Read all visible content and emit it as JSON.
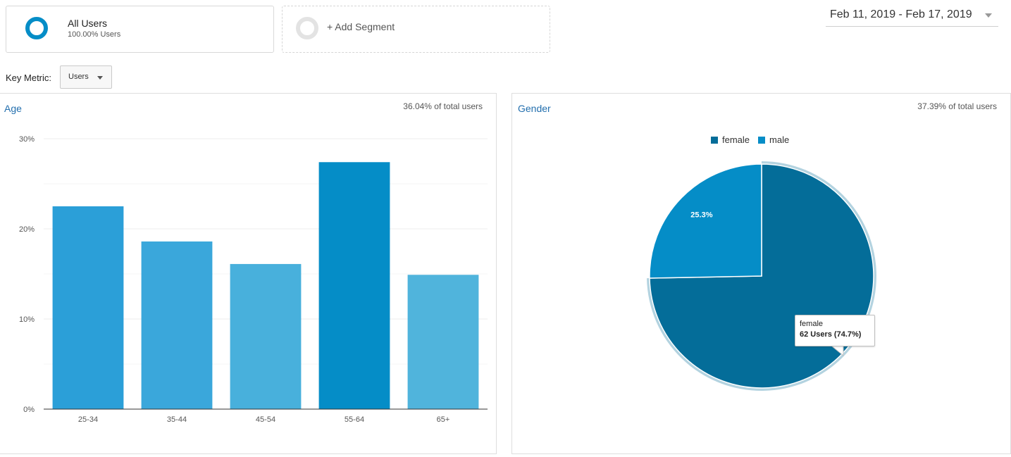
{
  "segments": {
    "active": {
      "name": "All Users",
      "subtitle": "100.00% Users",
      "color": "#058dc7"
    },
    "add_label": "+ Add Segment"
  },
  "date_range": {
    "label": "Feb 11, 2019 - Feb 17, 2019"
  },
  "key_metric": {
    "label": "Key Metric:",
    "value": "Users"
  },
  "age_panel": {
    "title": "Age",
    "stat": "36.04% of total users"
  },
  "gender_panel": {
    "title": "Gender",
    "stat": "37.39% of total users",
    "tooltip": {
      "label": "female",
      "value": "62 Users (74.7%)"
    }
  },
  "chart_data": [
    {
      "type": "bar",
      "title": "Age",
      "categories": [
        "25-34",
        "35-44",
        "45-54",
        "55-64",
        "65+"
      ],
      "values": [
        22.5,
        18.6,
        16.1,
        27.4,
        14.9
      ],
      "colors": [
        "#2b9fd8",
        "#3aa7db",
        "#48b0dc",
        "#058dc7",
        "#50b4dc"
      ],
      "ylim": [
        0,
        30
      ],
      "yticks": [
        0,
        10,
        20,
        30
      ],
      "ytick_labels": [
        "0%",
        "10%",
        "20%",
        "30%"
      ],
      "grid": true
    },
    {
      "type": "pie",
      "title": "Gender",
      "series": [
        {
          "name": "female",
          "value": 74.7,
          "color": "#046d99"
        },
        {
          "name": "male",
          "value": 25.3,
          "color": "#058dc7"
        }
      ],
      "data_labels": [
        "",
        "25.3%"
      ],
      "legend_position": "top"
    }
  ]
}
